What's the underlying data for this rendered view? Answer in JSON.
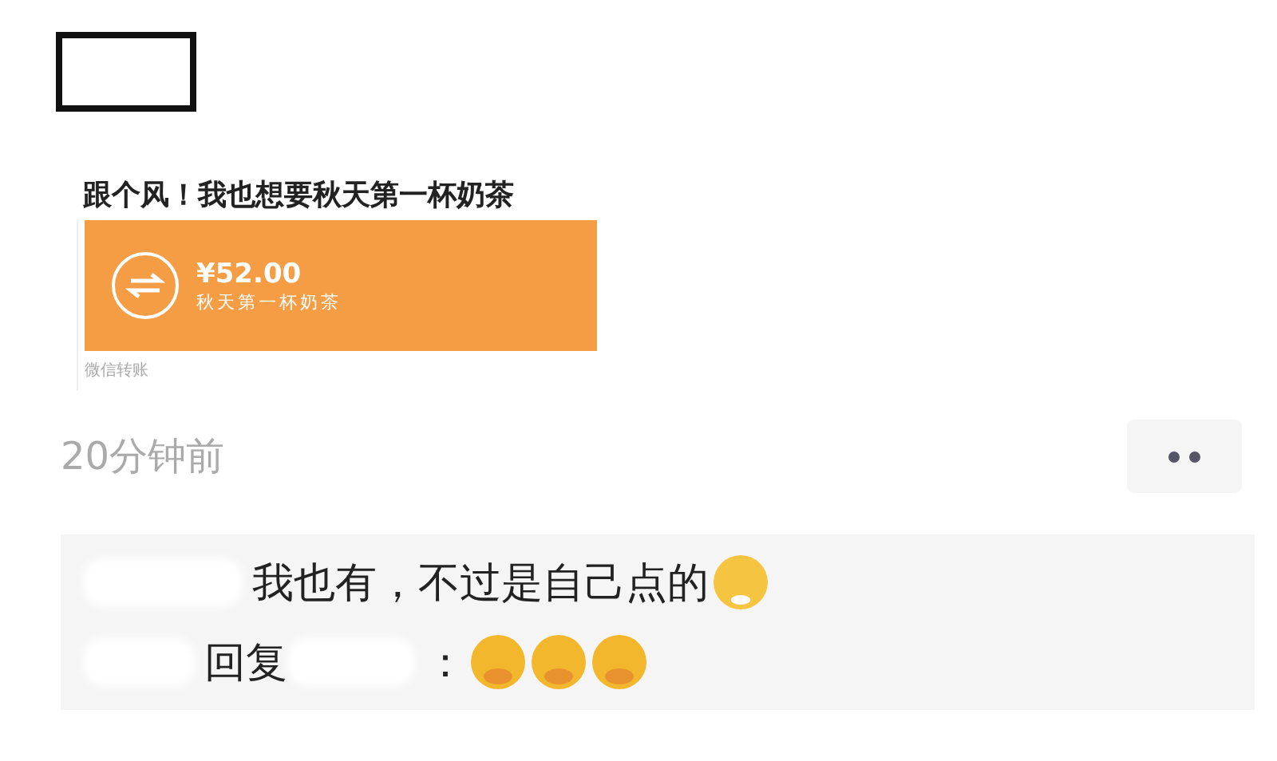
{
  "post": {
    "text": "跟个风！我也想要秋天第一杯奶茶",
    "transfer": {
      "amount": "¥52.00",
      "note": "秋天第一杯奶茶",
      "source": "微信转账"
    },
    "time": "20分钟前"
  },
  "comments": [
    {
      "kind": "comment",
      "text": "我也有，不过是自己点的",
      "emojis": [
        {
          "kind": "shy"
        }
      ]
    },
    {
      "kind": "reply",
      "reply_word": "回复",
      "text": "：",
      "emojis": [
        {
          "kind": "smirk"
        },
        {
          "kind": "smirk"
        },
        {
          "kind": "smirk"
        }
      ]
    }
  ]
}
